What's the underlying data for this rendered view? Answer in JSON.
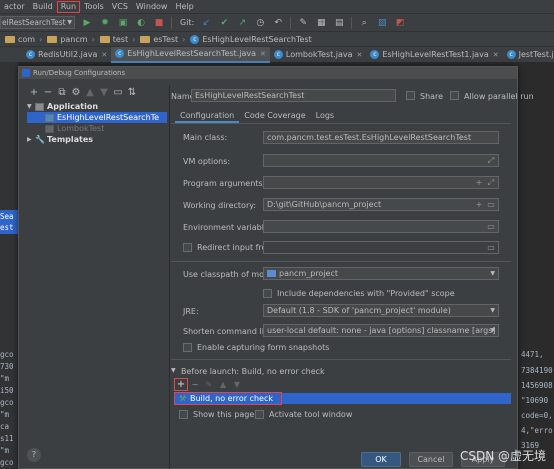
{
  "menu": {
    "items": [
      "actor",
      "Build",
      "Run",
      "Tools",
      "VCS",
      "Window",
      "Help"
    ],
    "active": "Run"
  },
  "toolbar": {
    "run_config": "elRestSearchTest",
    "git_label": "Git:"
  },
  "breadcrumbs": [
    "com",
    "pancm",
    "test",
    "esTest",
    "EsHighLevelRestSearchTest"
  ],
  "tabs": [
    {
      "label": "RedisUtil2.java",
      "active": false
    },
    {
      "label": "EsHighLevelRestSearchTest.java",
      "active": true
    },
    {
      "label": "LombokTest.java",
      "active": false
    },
    {
      "label": "EsHighLevelRestTest1.java",
      "active": false
    },
    {
      "label": "JestTest.java",
      "active": false
    }
  ],
  "background": {
    "left_lines": [
      "Sea",
      "est",
      "gco",
      "730",
      "\"m",
      "i50",
      "gco",
      "\"m",
      "ca",
      "s11",
      "\"m",
      "gco"
    ],
    "right_lines": [
      "4471,",
      "7384190",
      "1456908",
      "\"10690",
      "code=0,",
      "4,\"erro",
      "3169"
    ]
  },
  "dialog": {
    "title": "Run/Debug Configurations",
    "tree": {
      "application_label": "Application",
      "selected_item": "EsHighLevelRestSearchTe",
      "second_item": "LombokTest",
      "templates_label": "Templates"
    },
    "name_label": "Name:",
    "name_value": "EsHighLevelRestSearchTest",
    "share_label": "Share",
    "allow_parallel_label": "Allow parallel run",
    "inner_tabs": [
      "Configuration",
      "Code Coverage",
      "Logs"
    ],
    "main_class_label": "Main class:",
    "main_class_value": "com.pancm.test.esTest.EsHighLevelRestSearchTest",
    "vm_options_label": "VM options:",
    "program_args_label": "Program arguments:",
    "working_dir_label": "Working directory:",
    "working_dir_value": "D:\\git\\GitHub\\pancm_project",
    "env_vars_label": "Environment variables:",
    "redirect_input_label": "Redirect input from:",
    "classpath_label": "Use classpath of module:",
    "classpath_value": "pancm_project",
    "include_deps_label": "Include dependencies with \"Provided\" scope",
    "jre_label": "JRE:",
    "jre_value": "Default (1.8 - SDK of 'pancm_project' module)",
    "shorten_label": "Shorten command line:",
    "shorten_value": "user-local default: none - java [options] classname [args]",
    "snapshots_label": "Enable capturing form snapshots",
    "before_launch_label": "Before launch: Build, no error check",
    "before_launch_item": "Build, no error check",
    "show_page_label": "Show this page",
    "activate_tool_label": "Activate tool window",
    "ok_label": "OK",
    "cancel_label": "Cancel",
    "apply_label": "Apply"
  },
  "watermark": "CSDN @虚无境"
}
